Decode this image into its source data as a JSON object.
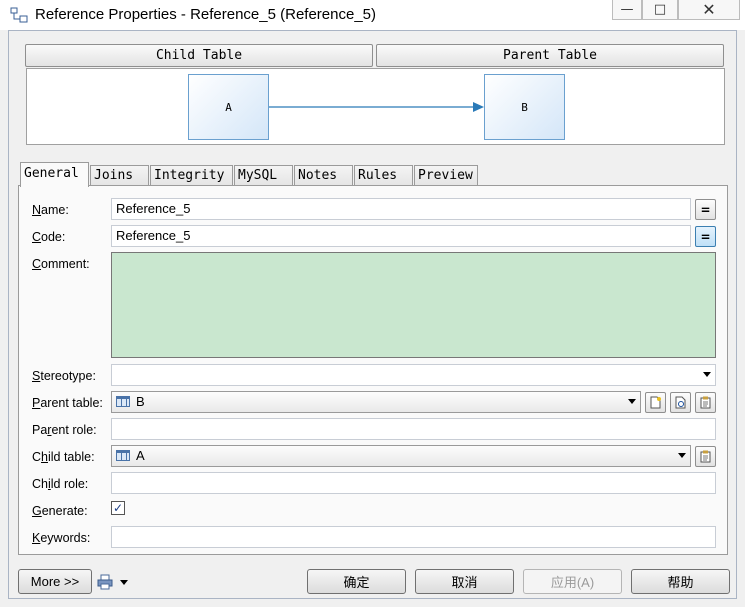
{
  "window": {
    "title": "Reference Properties - Reference_5 (Reference_5)",
    "minimize_glyph": "—",
    "maximize_glyph": "□",
    "close_glyph": "✕"
  },
  "header": {
    "child_table_label": "Child Table",
    "parent_table_label": "Parent Table"
  },
  "diagram": {
    "child_entity": "A",
    "parent_entity": "B"
  },
  "tabs": [
    {
      "label": "General",
      "active": true
    },
    {
      "label": "Joins"
    },
    {
      "label": "Integrity"
    },
    {
      "label": "MySQL"
    },
    {
      "label": "Notes"
    },
    {
      "label": "Rules"
    },
    {
      "label": "Preview"
    }
  ],
  "form": {
    "name": {
      "label_u": "N",
      "label_rest": "ame:",
      "value": "Reference_5"
    },
    "code": {
      "label_u": "C",
      "label_rest": "ode:",
      "value": "Reference_5"
    },
    "comment": {
      "label_u": "C",
      "label_rest": "omment:",
      "value": ""
    },
    "stereotype": {
      "label_u": "S",
      "label_rest": "tereotype:",
      "value": ""
    },
    "parent_table": {
      "label_u": "P",
      "label_rest": "arent table:",
      "value": "B"
    },
    "parent_role": {
      "label_pre": "Pa",
      "label_u": "r",
      "label_rest": "ent role:",
      "value": ""
    },
    "child_table": {
      "label_pre": "C",
      "label_u": "h",
      "label_rest": "ild table:",
      "value": "A"
    },
    "child_role": {
      "label_pre": "Ch",
      "label_u": "i",
      "label_rest": "ld role:",
      "value": ""
    },
    "generate": {
      "label_u": "G",
      "label_rest": "enerate:",
      "checked": true,
      "check_glyph": "✓"
    },
    "keywords": {
      "label_u": "K",
      "label_rest": "eywords:",
      "value": ""
    },
    "equals_glyph": "="
  },
  "footer": {
    "more_label": "More >>",
    "ok_label": "确定",
    "cancel_label": "取消",
    "apply_label": "应用(A)",
    "help_label": "帮助"
  },
  "icons": {
    "window_icon": "reference-diagram-icon",
    "printer": "printer-icon",
    "new_object": "new-object-icon",
    "browse": "browse-icon",
    "properties": "properties-icon"
  },
  "colors": {
    "comment_bg": "#c9e7cf",
    "entity_border": "#6aa0cf",
    "arrow": "#2a7ab8"
  }
}
